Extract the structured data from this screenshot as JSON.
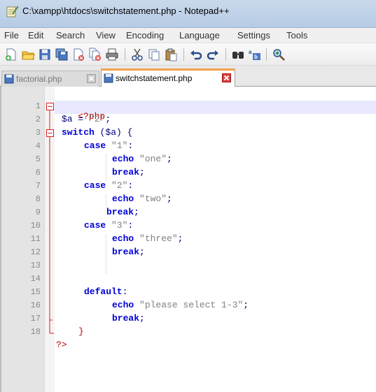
{
  "window": {
    "title": "C:\\xampp\\htdocs\\switchstatement.php - Notepad++"
  },
  "menu": {
    "items": [
      "File",
      "Edit",
      "Search",
      "View",
      "Encoding",
      "Language",
      "Settings",
      "Tools"
    ]
  },
  "toolbar": {
    "buttons": [
      "new-file-icon",
      "open-file-icon",
      "save-icon",
      "save-all-icon",
      "close-icon",
      "close-all-icon",
      "print-icon",
      "cut-icon",
      "copy-icon",
      "paste-icon",
      "undo-icon",
      "redo-icon",
      "find-icon",
      "replace-icon",
      "zoom-in-icon"
    ]
  },
  "tabs": [
    {
      "label": "factorial.php",
      "active": false
    },
    {
      "label": "switchstatement.php",
      "active": true
    }
  ],
  "editor": {
    "line_numbers": [
      "1",
      "2",
      "3",
      "4",
      "5",
      "6",
      "7",
      "8",
      "9",
      "10",
      "11",
      "12",
      "13",
      "14",
      "15",
      "16",
      "17",
      "18"
    ],
    "lines": {
      "l1_tag": "<?php",
      "l2_var": "$a",
      "l2_op": " = ",
      "l2_str": "\"2\"",
      "l2_semi": ";",
      "l3_kw": "switch",
      "l3_rest": " ($a) {",
      "l4_kw": "case",
      "l4_str": " \"1\"",
      "l4_colon": ":",
      "l5_kw": "echo",
      "l5_str": " \"one\"",
      "l5_semi": ";",
      "l6_kw": "break",
      "l6_semi": ";",
      "l7_kw": "case",
      "l7_str": " \"2\"",
      "l7_colon": ":",
      "l8_kw": "echo",
      "l8_str": " \"two\"",
      "l8_semi": ";",
      "l9_kw": "break",
      "l9_semi": ";",
      "l10_kw": "case",
      "l10_str": " \"3\"",
      "l10_colon": ":",
      "l11_kw": "echo",
      "l11_str": " \"three\"",
      "l11_semi": ";",
      "l12_kw": "break",
      "l12_semi": ";",
      "l14_kw": "default",
      "l14_colon": ":",
      "l15_kw": "echo",
      "l15_str": " \"please select 1-3\"",
      "l15_semi": ";",
      "l16_kw": "break",
      "l16_semi": ";",
      "l17_brace": "}",
      "l18_tag": "?>"
    }
  },
  "colors": {
    "keyword": "#0000d8",
    "string": "#808080",
    "php_tag": "#c00000",
    "variable": "#000080",
    "current_line": "#e8e8ff",
    "active_tab_accent": "#f3a24a"
  }
}
